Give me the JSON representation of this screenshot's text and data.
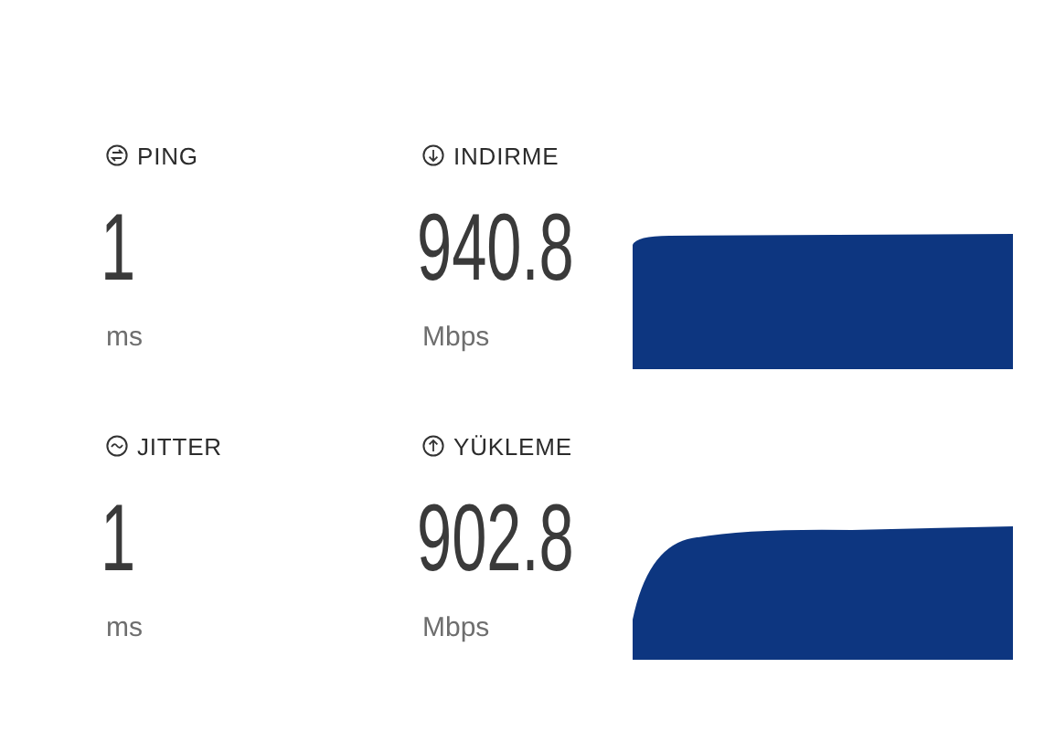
{
  "rows": [
    {
      "metrics": [
        {
          "kind": "ping",
          "label": "PING",
          "value": "1",
          "unit": "ms"
        },
        {
          "kind": "download",
          "label": "INDIRME",
          "value": "940.8",
          "unit": "Mbps"
        }
      ]
    },
    {
      "metrics": [
        {
          "kind": "jitter",
          "label": "JITTER",
          "value": "1",
          "unit": "ms"
        },
        {
          "kind": "upload",
          "label": "YÜKLEME",
          "value": "902.8",
          "unit": "Mbps"
        }
      ]
    }
  ]
}
